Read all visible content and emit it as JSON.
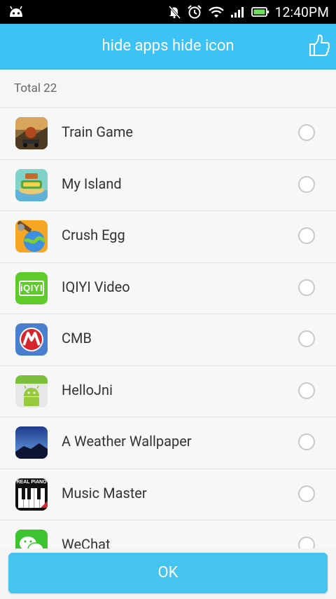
{
  "status_bar": {
    "time": "12:40PM"
  },
  "app_bar": {
    "title": "hide apps hide icon"
  },
  "total_label": "Total 22",
  "apps": [
    {
      "name": "Train Game",
      "icon": "train-game-icon",
      "selected": false
    },
    {
      "name": "My Island",
      "icon": "my-island-icon",
      "selected": false
    },
    {
      "name": "Crush Egg",
      "icon": "crush-egg-icon",
      "selected": false
    },
    {
      "name": "IQIYI Video",
      "icon": "iqiyi-icon",
      "selected": false
    },
    {
      "name": "CMB",
      "icon": "cmb-icon",
      "selected": false
    },
    {
      "name": "HelloJni",
      "icon": "android-icon",
      "selected": false
    },
    {
      "name": "A Weather Wallpaper",
      "icon": "weather-wallpaper-icon",
      "selected": false
    },
    {
      "name": "Music Master",
      "icon": "piano-icon",
      "selected": false
    },
    {
      "name": "WeChat",
      "icon": "wechat-icon",
      "selected": false
    }
  ],
  "music_master_badge": "REAL PIANO",
  "iqiyi_badge": "iQIYI",
  "ok_label": "OK",
  "colors": {
    "accent": "#3cc3f3",
    "ok_button": "#45c4f0"
  }
}
